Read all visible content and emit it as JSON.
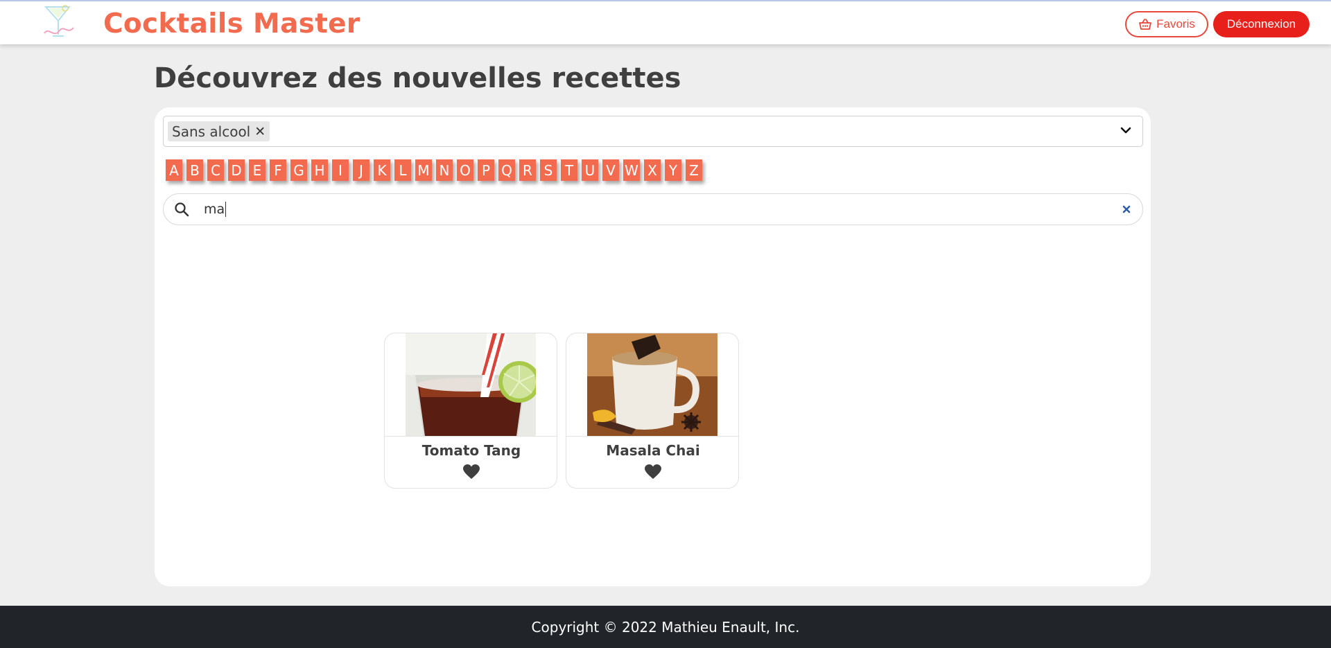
{
  "header": {
    "brand": "Cocktails Master",
    "favorites_label": "Favoris",
    "logout_label": "Déconnexion"
  },
  "page": {
    "title": "Découvrez des nouvelles recettes"
  },
  "filter": {
    "selected_chip": "Sans alcool"
  },
  "letters": [
    "A",
    "B",
    "C",
    "D",
    "E",
    "F",
    "G",
    "H",
    "I",
    "J",
    "K",
    "L",
    "M",
    "N",
    "O",
    "P",
    "Q",
    "R",
    "S",
    "T",
    "U",
    "V",
    "W",
    "X",
    "Y",
    "Z"
  ],
  "search": {
    "value": "ma"
  },
  "results": [
    {
      "name": "Tomato Tang"
    },
    {
      "name": "Masala Chai"
    }
  ],
  "footer": {
    "copyright": "Copyright © 2022 Mathieu Enault, Inc."
  },
  "colors": {
    "brand": "#f36b4f",
    "danger": "#e8201b",
    "footer_bg": "#212429"
  },
  "icons": [
    "cocktail-logo-icon",
    "basket-icon",
    "close-icon",
    "chevron-down-icon",
    "search-icon",
    "clear-icon",
    "heart-icon"
  ]
}
